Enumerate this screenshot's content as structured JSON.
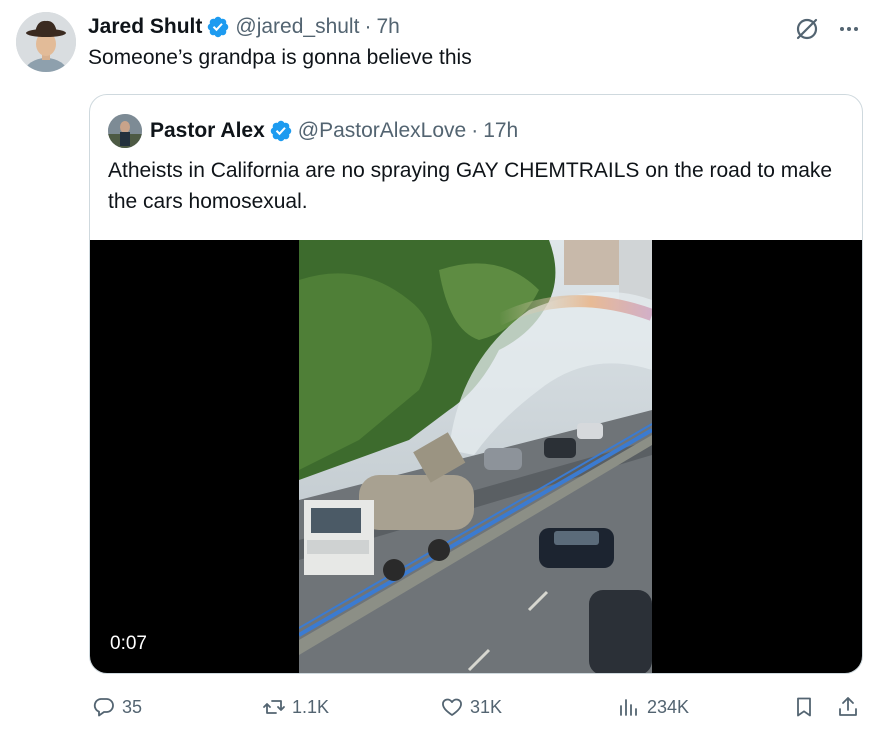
{
  "tweet": {
    "author_name": "Jared Shult",
    "author_handle": "@jared_shult",
    "separator": "·",
    "time": "7h",
    "text": "Someone’s grandpa is gonna believe this"
  },
  "quoted_tweet": {
    "author_name": "Pastor Alex",
    "author_handle": "@PastorAlexLove",
    "separator": "·",
    "time": "17h",
    "text": "Atheists in California are no spraying GAY CHEMTRAILS on the road to make the cars homosexual.",
    "video_timestamp": "0:07"
  },
  "actions": {
    "replies": "35",
    "retweets": "1.1K",
    "likes": "31K",
    "views": "234K"
  },
  "icons": {
    "verified": "verified-badge-icon",
    "grok": "grok-icon",
    "more": "more-icon",
    "reply": "reply-icon",
    "retweet": "retweet-icon",
    "like": "heart-icon",
    "views": "views-icon",
    "bookmark": "bookmark-icon",
    "share": "share-icon"
  },
  "colors": {
    "verified": "#1d9bf0",
    "secondary_text": "#536471",
    "primary_text": "#0f1419",
    "border": "#cfd9de"
  }
}
